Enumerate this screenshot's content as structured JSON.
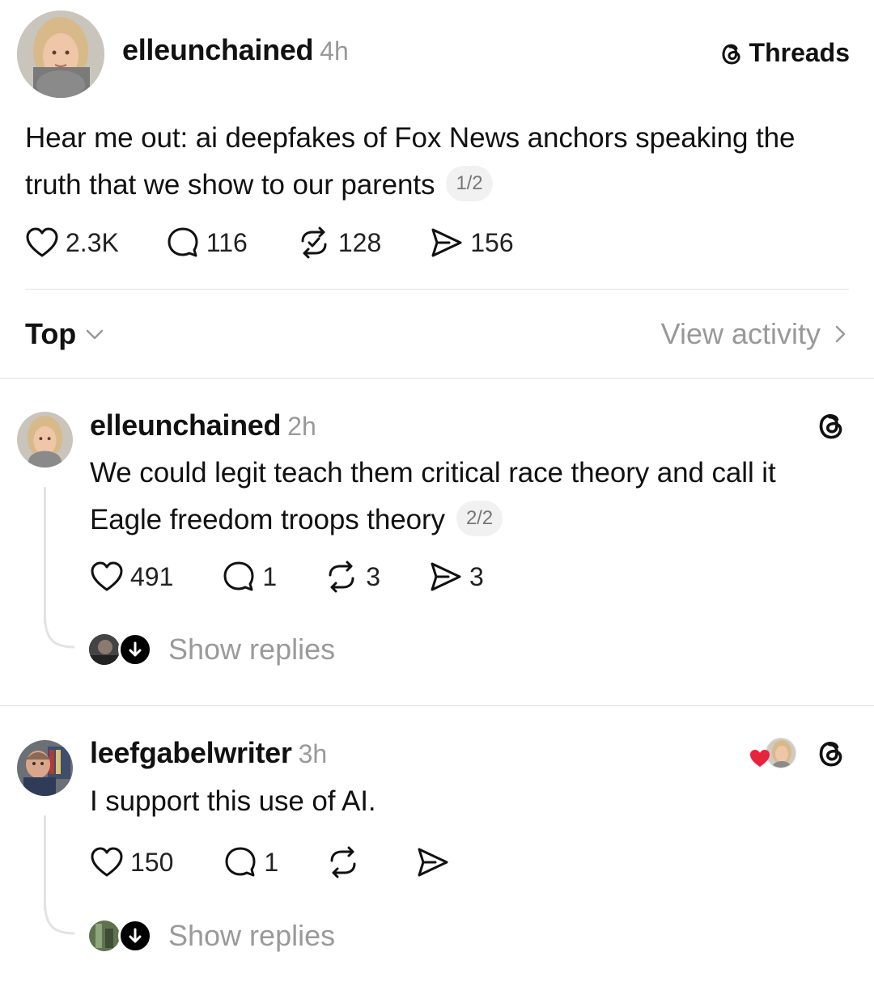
{
  "post": {
    "username": "elleunchained",
    "time": "4h",
    "brand": "Threads",
    "text": "Hear me out: ai deepfakes of Fox News anchors speaking the truth that we show to our parents",
    "pager": "1/2",
    "likes": "2.3K",
    "comments": "116",
    "reposts": "128",
    "shares": "156"
  },
  "sort": {
    "label": "Top",
    "activity": "View activity"
  },
  "replies": [
    {
      "username": "elleunchained",
      "time": "2h",
      "text": "We could legit teach them critical race theory and call it Eagle freedom troops theory",
      "pager": "2/2",
      "likes": "491",
      "comments": "1",
      "reposts": "3",
      "shares": "3",
      "show_replies": "Show replies"
    },
    {
      "username": "leefgabelwriter",
      "time": "3h",
      "text": "I support this use of AI.",
      "likes": "150",
      "comments": "1",
      "reposts": "",
      "shares": "",
      "show_replies": "Show replies"
    }
  ],
  "icons": {
    "heart": "heart-icon",
    "comment": "comment-icon",
    "repost": "repost-icon",
    "share": "share-icon",
    "threads": "threads-logo-icon",
    "chevron": "chevron-icon"
  },
  "colors": {
    "text": "#111111",
    "muted": "#999999",
    "like_heart": "#e8243c"
  }
}
